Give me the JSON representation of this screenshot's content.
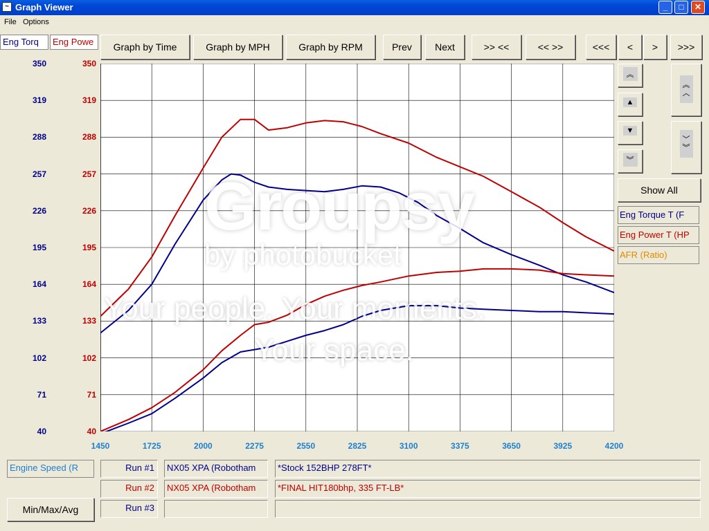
{
  "window": {
    "title": "Graph Viewer"
  },
  "menu": [
    "File",
    "Options"
  ],
  "tabs": {
    "torque": "Eng Torq",
    "power": "Eng Powe"
  },
  "toolbar": {
    "by_time": "Graph by Time",
    "by_mph": "Graph by MPH",
    "by_rpm": "Graph by RPM",
    "prev": "Prev",
    "next": "Next",
    "zoom_in": ">> <<",
    "zoom_out": "<< >>",
    "first": "<<<",
    "back": "<",
    "forward": ">",
    "last": ">>>"
  },
  "right_panel": {
    "show_all": "Show All",
    "legend": [
      {
        "label": "Eng Torque T (F",
        "color": "#00008B"
      },
      {
        "label": "Eng Power T (HP",
        "color": "#C00000"
      },
      {
        "label": "AFR (Ratio)",
        "color": "#E08A00"
      }
    ]
  },
  "bottom": {
    "x_channel": "Engine Speed (R",
    "min_max_avg": "Min/Max/Avg",
    "runs": [
      {
        "label": "Run #1",
        "vehicle": "NX05 XPA (Robotham",
        "note": "*Stock 152BHP 278FT*",
        "color": "#00008B"
      },
      {
        "label": "Run #2",
        "vehicle": "NX05 XPA (Robotham",
        "note": "*FINAL HIT180bhp, 335 FT-LB*",
        "color": "#C00000"
      },
      {
        "label": "Run #3",
        "vehicle": "",
        "note": "",
        "color": "#00008B"
      }
    ]
  },
  "watermark": {
    "brand": "Groupsy",
    "sub": "by photobucket",
    "tagline1": "Your people. Your moments.",
    "tagline2": "Your space."
  },
  "chart_data": {
    "type": "line",
    "x_ticks": [
      1450,
      1725,
      2000,
      2275,
      2550,
      2825,
      3100,
      3375,
      3650,
      3925,
      4200
    ],
    "y_ticks": [
      40,
      71,
      102,
      133,
      164,
      195,
      226,
      257,
      288,
      319,
      350
    ],
    "xlim": [
      1450,
      4200
    ],
    "ylim": [
      40,
      350
    ],
    "grid": true,
    "series": [
      {
        "name": "Eng Torque T (F",
        "run": "Run #2",
        "color": "#C00000",
        "x": [
          1450,
          1600,
          1725,
          1850,
          2000,
          2100,
          2200,
          2275,
          2350,
          2450,
          2550,
          2650,
          2750,
          2850,
          2950,
          3100,
          3250,
          3375,
          3500,
          3650,
          3800,
          3925,
          4050,
          4200
        ],
        "y": [
          137,
          160,
          187,
          222,
          262,
          288,
          303,
          303,
          294,
          296,
          300,
          302,
          301,
          297,
          291,
          283,
          271,
          263,
          255,
          242,
          229,
          216,
          204,
          192
        ]
      },
      {
        "name": "Eng Torque T (F",
        "run": "Run #1",
        "color": "#00008B",
        "x": [
          1450,
          1600,
          1725,
          1850,
          2000,
          2100,
          2150,
          2200,
          2275,
          2350,
          2450,
          2550,
          2650,
          2750,
          2850,
          2950,
          3050,
          3150,
          3250,
          3375,
          3500,
          3650,
          3800,
          3925,
          4050,
          4200
        ],
        "y": [
          123,
          142,
          164,
          198,
          235,
          252,
          257,
          256,
          250,
          246,
          244,
          243,
          242,
          244,
          247,
          246,
          241,
          233,
          222,
          211,
          199,
          189,
          180,
          172,
          166,
          157
        ]
      },
      {
        "name": "Eng Power T (HP",
        "run": "Run #2",
        "color": "#C00000",
        "x": [
          1450,
          1600,
          1725,
          1850,
          2000,
          2100,
          2200,
          2275,
          2350,
          2450,
          2550,
          2650,
          2750,
          2850,
          2950,
          3100,
          3250,
          3375,
          3500,
          3650,
          3800,
          3925,
          4050,
          4200
        ],
        "y": [
          40,
          50,
          60,
          73,
          92,
          108,
          121,
          130,
          132,
          138,
          147,
          154,
          159,
          163,
          166,
          171,
          174,
          175,
          177,
          177,
          176,
          173,
          172,
          171
        ]
      },
      {
        "name": "Eng Power T (HP",
        "run": "Run #1",
        "color": "#00008B",
        "x": [
          1450,
          1600,
          1725,
          1850,
          2000,
          2100,
          2200,
          2275,
          2350,
          2450,
          2550,
          2650,
          2750,
          2850,
          2950,
          3100,
          3250,
          3375,
          3500,
          3650,
          3800,
          3925,
          4050,
          4200
        ],
        "y": [
          38,
          47,
          55,
          68,
          85,
          98,
          107,
          109,
          111,
          116,
          121,
          125,
          130,
          137,
          142,
          146,
          146,
          144,
          143,
          142,
          141,
          141,
          140,
          139
        ]
      }
    ]
  }
}
